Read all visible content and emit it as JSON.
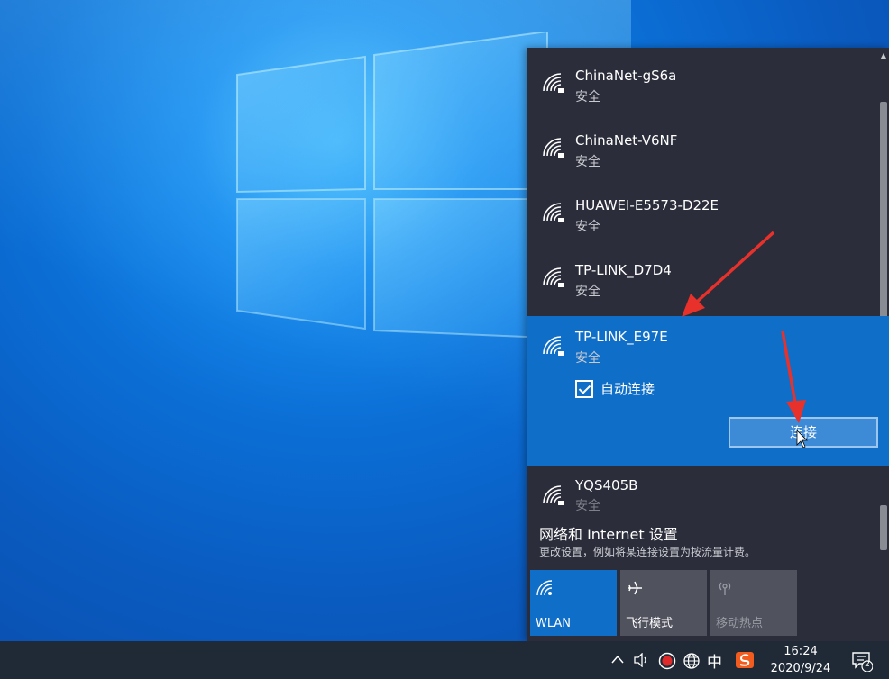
{
  "networks": [
    {
      "ssid": "ChinaNet-gS6a",
      "security": "安全"
    },
    {
      "ssid": "ChinaNet-V6NF",
      "security": "安全"
    },
    {
      "ssid": "HUAWEI-E5573-D22E",
      "security": "安全"
    },
    {
      "ssid": "TP-LINK_D7D4",
      "security": "安全"
    },
    {
      "ssid": "TP-LINK_E97E",
      "security": "安全"
    },
    {
      "ssid": "YQS405B",
      "security": "安全"
    }
  ],
  "selected": {
    "autoconnect_label": "自动连接",
    "autoconnect_checked": true,
    "connect_label": "连接"
  },
  "settings": {
    "title": "网络和 Internet 设置",
    "description": "更改设置，例如将某连接设置为按流量计费。"
  },
  "quick_actions": [
    {
      "label": "WLAN",
      "icon": "wifi-icon",
      "active": true
    },
    {
      "label": "飞行模式",
      "icon": "airplane-icon",
      "active": false
    },
    {
      "label": "移动热点",
      "icon": "hotspot-icon",
      "active": false
    }
  ],
  "taskbar": {
    "ime": "中",
    "time": "16:24",
    "date": "2020/9/24",
    "notification_count": "2"
  },
  "colors": {
    "accent": "#0f6ec7",
    "flyout_bg": "#2b2d3a",
    "taskbar_bg": "#1f2a36",
    "annotation_arrow": "#e8312b"
  }
}
